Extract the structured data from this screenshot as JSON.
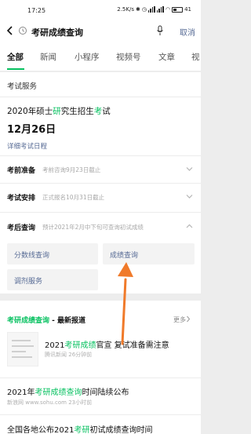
{
  "status_bar": {
    "time": "17:25",
    "speed": "2.5K/s",
    "battery": "41"
  },
  "search": {
    "query": "考研成绩查询",
    "cancel_label": "取消"
  },
  "tabs": [
    {
      "label": "全部",
      "active": true
    },
    {
      "label": "新闻",
      "active": false
    },
    {
      "label": "小程序",
      "active": false
    },
    {
      "label": "视频号",
      "active": false
    },
    {
      "label": "文章",
      "active": false
    },
    {
      "label": "视",
      "active": false
    }
  ],
  "exam_card": {
    "header": "考试服务",
    "exam_name": {
      "prefix": "2020年硕士",
      "hl1": "研",
      "mid": "究生招生",
      "hl2": "考",
      "suffix": "试"
    },
    "date": "12月26日",
    "schedule_link": "详细考试日程",
    "rows": [
      {
        "label": "考前准备",
        "sub": "考前咨询9月23日截止"
      },
      {
        "label": "考试安排",
        "sub": "正式报名10月31日截止"
      },
      {
        "label": "考后查询",
        "sub": "预计2021年2月中下旬可查询初试成绩"
      }
    ],
    "sub_buttons": [
      "分数线查询",
      "成绩查询",
      "调剂服务"
    ]
  },
  "news": {
    "title_hl": "考研成绩查询",
    "title_rest": " - 最新报道",
    "more_label": "更多",
    "items": [
      {
        "pre": "2021",
        "hl": "考研成绩",
        "post": "官宣 复试准备需注意",
        "source": "腾讯新闻",
        "time": "26分钟前"
      },
      {
        "pre": "2021年",
        "hl": "考研成绩查询",
        "post": "时间陆续公布",
        "source": "新浪网 www.sohu.com",
        "time": "23小时前"
      },
      {
        "pre": "全国各地公布2021",
        "hl": "考研",
        "post": "初试成绩查询时间",
        "source": "",
        "time": ""
      }
    ]
  },
  "colors": {
    "accent_green": "#07c160",
    "link_blue": "#576b95",
    "annotation_arrow": "#f07a2a"
  },
  "icons": [
    "back-icon",
    "history-icon",
    "microphone-icon",
    "chevron-down-icon",
    "chevron-up-icon",
    "chevron-right-icon",
    "orange-arrow-annotation"
  ]
}
